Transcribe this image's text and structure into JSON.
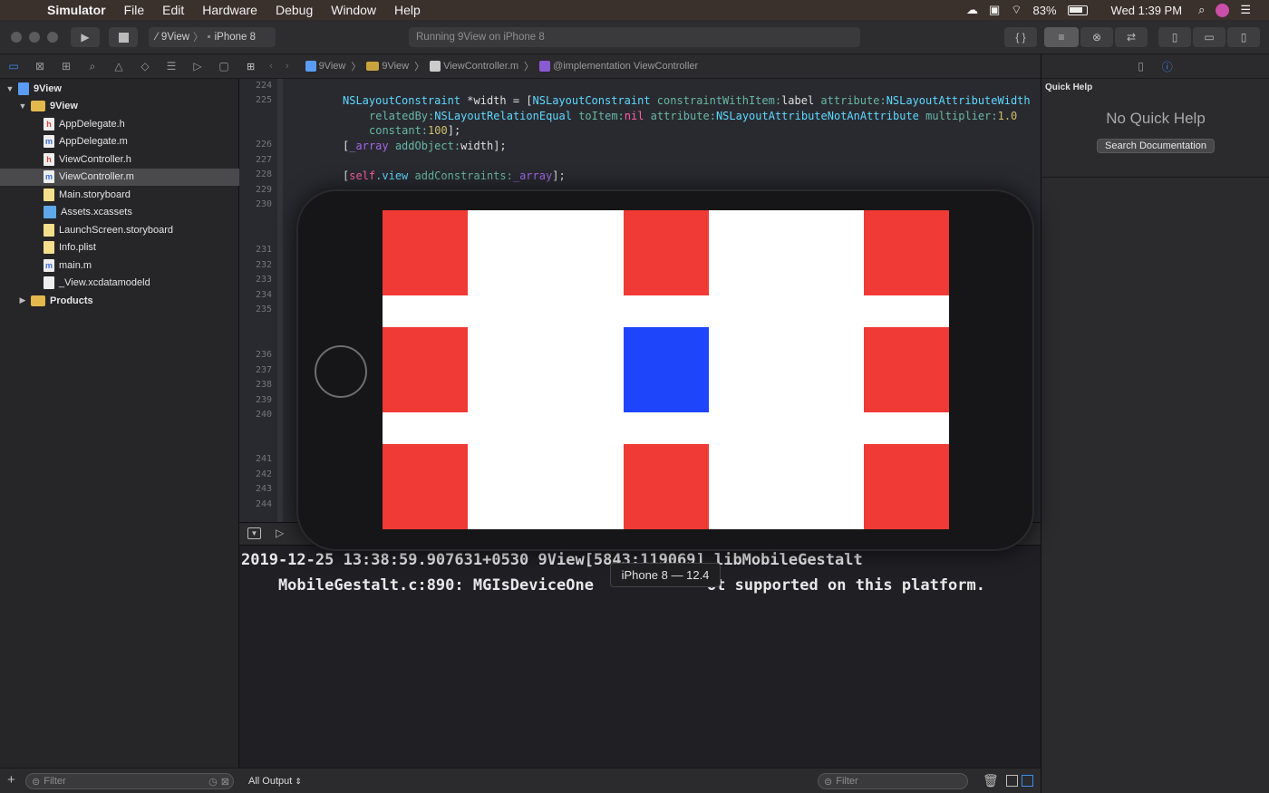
{
  "menubar": {
    "app": "Simulator",
    "items": [
      "File",
      "Edit",
      "Hardware",
      "Debug",
      "Window",
      "Help"
    ],
    "battery": "83%",
    "clock": "Wed 1:39 PM"
  },
  "toolbar": {
    "scheme_project": "9View",
    "scheme_device": "iPhone 8",
    "activity": "Running 9View on iPhone 8"
  },
  "navigator": {
    "items": [
      {
        "label": "9View",
        "icon": "project-icon",
        "indent": 0,
        "disclosure": "▼"
      },
      {
        "label": "9View",
        "icon": "folder-icon",
        "indent": 1,
        "disclosure": "▼"
      },
      {
        "label": "AppDelegate.h",
        "icon": "header-file-icon",
        "indent": 2,
        "disclosure": ""
      },
      {
        "label": "AppDelegate.m",
        "icon": "objc-file-icon",
        "indent": 2,
        "disclosure": ""
      },
      {
        "label": "ViewController.h",
        "icon": "header-file-icon",
        "indent": 2,
        "disclosure": ""
      },
      {
        "label": "ViewController.m",
        "icon": "objc-file-icon",
        "indent": 2,
        "disclosure": ""
      },
      {
        "label": "Main.storyboard",
        "icon": "storyboard-icon",
        "indent": 2,
        "disclosure": ""
      },
      {
        "label": "Assets.xcassets",
        "icon": "assets-icon",
        "indent": 2,
        "disclosure": ""
      },
      {
        "label": "LaunchScreen.storyboard",
        "icon": "storyboard-icon",
        "indent": 2,
        "disclosure": ""
      },
      {
        "label": "Info.plist",
        "icon": "plist-icon",
        "indent": 2,
        "disclosure": ""
      },
      {
        "label": "main.m",
        "icon": "objc-file-icon",
        "indent": 2,
        "disclosure": ""
      },
      {
        "label": "_View.xcdatamodeld",
        "icon": "datamodel-icon",
        "indent": 2,
        "disclosure": ""
      },
      {
        "label": "Products",
        "icon": "folder-icon",
        "indent": 1,
        "disclosure": "▶"
      }
    ],
    "selected": "ViewController.m",
    "filter_placeholder": "Filter"
  },
  "jumpbar": {
    "crumbs": [
      "9View",
      "9View",
      "ViewController.m",
      "@implementation ViewController"
    ]
  },
  "editor": {
    "line_numbers": [
      "224",
      "225",
      "226",
      "227",
      "228",
      "229",
      "230",
      "231",
      "232",
      "233",
      "234",
      "235",
      "236",
      "237",
      "238",
      "239",
      "240",
      "241",
      "242",
      "243",
      "244"
    ],
    "code": {
      "l225a_type": "NSLayoutConstraint",
      "l225a_var": " *width = [",
      "l225a_cls": "NSLayoutConstraint",
      "l225a_sel": " constraintWithItem:",
      "l225a_arg": "label",
      "l225a_attr": " attribute:",
      "l225a_const": "NSLayoutAttributeWidth",
      "l225b_sel": "relatedBy:",
      "l225b_const": "NSLayoutRelationEqual",
      "l225b_sel2": " toItem:",
      "l225b_nil": "nil",
      "l225b_sel3": " attribute:",
      "l225b_const2": "NSLayoutAttributeNotAnAttribute",
      "l225b_sel4": " multiplier:",
      "l225b_num": "1.0",
      "l225c_sel": "constant:",
      "l225c_num": "100",
      "l225c_end": "];",
      "l226_open": "[",
      "l226_iv": "_array",
      "l226_sel": " addObject:",
      "l226_end": "width];",
      "l228_open": "[",
      "l228_self": "self",
      "l228_view": ".view",
      "l228_sel": " addConstraints:",
      "l228_iv": "_array",
      "l228_end": "];"
    }
  },
  "console": {
    "line1": "2019-12-25 13:38:59.907631+0530 9View[5843:119069] libMobileGestalt",
    "line2": "    MobileGestalt.c:890: MGIsDeviceOne",
    "line2_tail": "ot supported on this platform.",
    "output_selector": "All Output",
    "filter_placeholder": "Filter"
  },
  "inspector": {
    "title": "Quick Help",
    "empty": "No Quick Help",
    "button": "Search Documentation"
  },
  "simulator": {
    "tooltip": "iPhone 8 — 12.4",
    "colors": {
      "red": "#ef3a35",
      "blue": "#1f45fb",
      "background": "#ffffff"
    },
    "grid": [
      [
        "red",
        "red",
        "red"
      ],
      [
        "red",
        "blue",
        "red"
      ],
      [
        "red",
        "red",
        "red"
      ]
    ]
  }
}
